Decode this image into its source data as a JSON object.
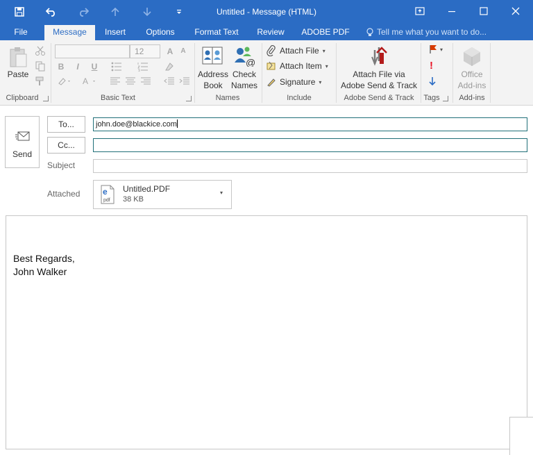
{
  "window": {
    "title": "Untitled - Message (HTML)"
  },
  "tabs": [
    {
      "label": "File"
    },
    {
      "label": "Message"
    },
    {
      "label": "Insert"
    },
    {
      "label": "Options"
    },
    {
      "label": "Format Text"
    },
    {
      "label": "Review"
    },
    {
      "label": "ADOBE PDF"
    }
  ],
  "tell_me": "Tell me what you want to do...",
  "ribbon": {
    "clipboard": {
      "paste": "Paste",
      "group": "Clipboard"
    },
    "basic_text": {
      "font_size": "12",
      "group": "Basic Text"
    },
    "names": {
      "address_book_1": "Address",
      "address_book_2": "Book",
      "check_names_1": "Check",
      "check_names_2": "Names",
      "group": "Names"
    },
    "include": {
      "attach_file": "Attach File",
      "attach_item": "Attach Item",
      "signature": "Signature",
      "group": "Include"
    },
    "adobe": {
      "line1": "Attach File via",
      "line2": "Adobe Send & Track",
      "group": "Adobe Send & Track"
    },
    "tags": {
      "group": "Tags"
    },
    "addins": {
      "office_1": "Office",
      "office_2": "Add-ins",
      "group": "Add-ins"
    }
  },
  "compose": {
    "send": "Send",
    "to_button": "To...",
    "cc_button": "Cc...",
    "to_value": "john.doe@blackice.com",
    "cc_value": "",
    "subject_label": "Subject",
    "subject_value": "",
    "attached_label": "Attached",
    "attachment": {
      "name": "Untitled.PDF",
      "size": "38 KB"
    }
  },
  "body": {
    "line1": "Best Regards,",
    "line2": "John Walker"
  }
}
